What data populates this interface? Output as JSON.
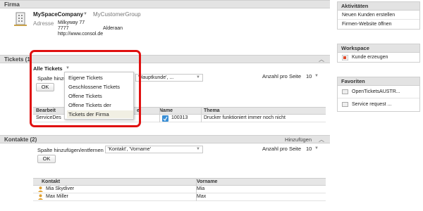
{
  "firma": {
    "title": "Firma",
    "company_name": "MySpaceCompany",
    "group": "MyCustomerGroup",
    "address_label": "Adresse",
    "street": "Milkyway 77",
    "zip": "7777",
    "city": "Alderaan",
    "website": "http://www.consol.de"
  },
  "tickets": {
    "title": "Tickets (1)",
    "filter_label": "Alle Tickets",
    "column_label_partial": "Spalte hinzu",
    "column_select_value": "'Hauptkunde', ...",
    "per_page_label": "Anzahl pro Seite",
    "per_page_value": "10",
    "ok_label": "OK",
    "dropdown_options": [
      "Eigene Tickets",
      "Geschlossene Tickets",
      "Offene Tickets",
      "Offene Tickets der Kontakte",
      "Tickets der Firma"
    ],
    "table": {
      "headers": [
        "Bearbeit",
        "e",
        "Name",
        "Thema"
      ],
      "rows": [
        {
          "bearbeiter": "ServiceDes",
          "col2": "",
          "name": "100313",
          "thema": "Drucker funktioniert immer noch nicht"
        }
      ]
    }
  },
  "kontakte": {
    "title": "Kontakte (2)",
    "add_label": "Hinzufügen",
    "column_label": "Spalte hinzufügen/entfernen",
    "column_select_value": "'Kontakt', 'Vorname'",
    "per_page_label": "Anzahl pro Seite",
    "per_page_value": "10",
    "ok_label": "OK",
    "table": {
      "headers": [
        "Kontakt",
        "Vorname"
      ],
      "rows": [
        {
          "kontakt": "Mia Skydiver",
          "vorname": "Mia"
        },
        {
          "kontakt": "Max Miller",
          "vorname": "Max"
        }
      ]
    }
  },
  "sidebar": {
    "aktivitaeten": {
      "title": "Aktivitäten",
      "items": [
        "Neuen Kunden erstellen",
        "Firmen-Website öffnen"
      ]
    },
    "workspace": {
      "title": "Workspace",
      "items": [
        "Kunde erzeugen"
      ]
    },
    "favoriten": {
      "title": "Favoriten",
      "items": [
        "OpenTicketsAUSTR...",
        "Service request ..."
      ]
    }
  },
  "colors": {
    "highlight": "#e01010",
    "section_header": "#e3e3e3"
  }
}
